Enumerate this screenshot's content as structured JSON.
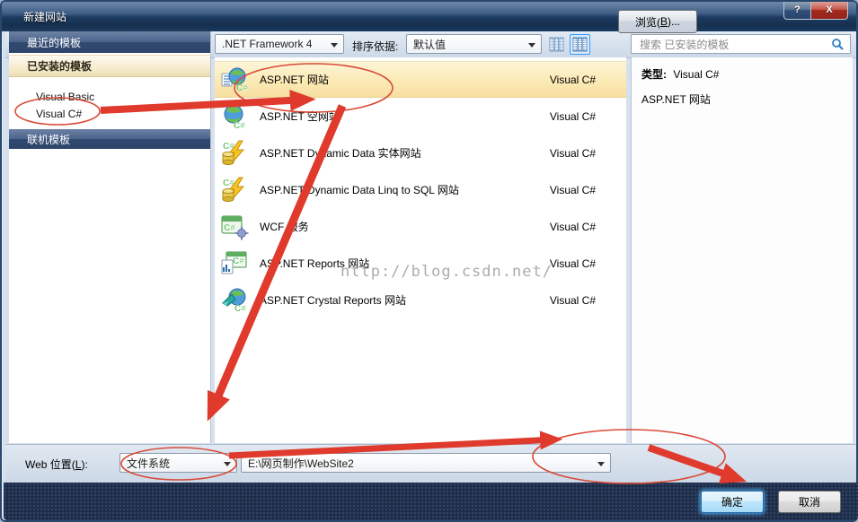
{
  "window": {
    "title": "新建网站",
    "help_glyph": "?",
    "close_glyph": "X"
  },
  "toolbar": {
    "framework_value": ".NET Framework 4",
    "sort_label": "排序依据:",
    "sort_value": "默认值"
  },
  "search": {
    "placeholder": "搜索 已安装的模板"
  },
  "sidebar": {
    "recent_header": "最近的模板",
    "installed_header": "已安装的模板",
    "items": [
      {
        "label": "Visual Basic"
      },
      {
        "label": "Visual C#"
      }
    ],
    "online_header": "联机模板"
  },
  "templates": {
    "items": [
      {
        "name": "ASP.NET 网站",
        "language": "Visual C#",
        "selected": true
      },
      {
        "name": "ASP.NET 空网站",
        "language": "Visual C#",
        "selected": false
      },
      {
        "name": "ASP.NET Dynamic Data 实体网站",
        "language": "Visual C#",
        "selected": false
      },
      {
        "name": "ASP.NET Dynamic Data Linq to SQL 网站",
        "language": "Visual C#",
        "selected": false
      },
      {
        "name": "WCF 服务",
        "language": "Visual C#",
        "selected": false
      },
      {
        "name": "ASP.NET Reports 网站",
        "language": "Visual C#",
        "selected": false
      },
      {
        "name": "ASP.NET Crystal Reports 网站",
        "language": "Visual C#",
        "selected": false
      }
    ]
  },
  "details": {
    "type_label": "类型:",
    "type_value": "Visual C#",
    "description": "ASP.NET 网站"
  },
  "footer": {
    "location_label": {
      "pre": "Web 位置(",
      "mnemonic": "L",
      "post": "):"
    },
    "location_type": "文件系统",
    "location_path": "E:\\网页制作\\WebSite2",
    "browse_label": {
      "pre": "浏览(",
      "mnemonic": "B",
      "post": ")..."
    },
    "ok_label": "确定",
    "cancel_label": "取消"
  },
  "watermark": {
    "text": "http://blog.csdn.net/"
  },
  "colors": {
    "annotation_red": "#df3a2b",
    "selection_cream": "#fbeab5",
    "titlebar_navy": "#1d3b62",
    "default_button_glow": "#57b0e8"
  }
}
